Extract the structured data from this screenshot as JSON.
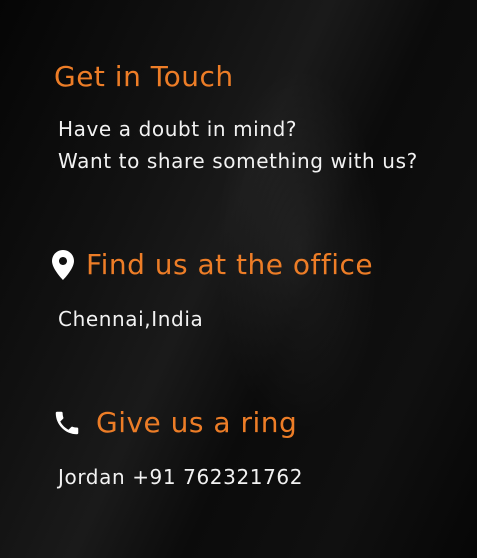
{
  "colors": {
    "accent": "#ed7d27",
    "text": "#f2f2f2",
    "icon": "#ffffff"
  },
  "contact": {
    "title": "Get in Touch",
    "intro_line1": "Have a doubt in mind?",
    "intro_line2": "Want to share something with us?"
  },
  "office": {
    "icon": "map-marker-icon",
    "title": "Find us at the office",
    "location": "Chennai,India"
  },
  "ring": {
    "icon": "phone-icon",
    "title": "Give us a ring",
    "phone": "Jordan +91 762321762"
  }
}
